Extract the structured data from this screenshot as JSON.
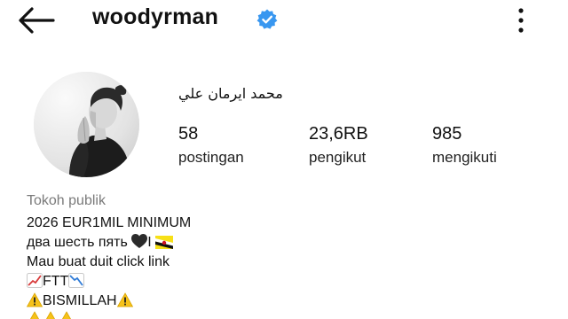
{
  "header": {
    "username": "woodyrman",
    "back_icon": "arrow-left-icon",
    "verified_icon": "verified-badge-icon",
    "more_icon": "more-vertical-icon",
    "verified_color": "#3897f0"
  },
  "profile": {
    "full_name": "محمد ايرمان علي",
    "stats": {
      "posts": {
        "value": "58",
        "label": "postingan"
      },
      "followers": {
        "value": "23,6RB",
        "label": "pengikut"
      },
      "following": {
        "value": "985",
        "label": "mengikuti"
      }
    }
  },
  "bio": {
    "category": "Tokoh publik",
    "line1": "2026 EUR1MIL MINIMUM",
    "line2": "два шесть пять",
    "line2_bar": "I",
    "line3": "Mau buat duit click link",
    "line4": "FTT",
    "line5": "BISMILLAH",
    "emojis": {
      "heart": "black-heart-icon",
      "flag": "brunei-flag-icon",
      "chart_up": "chart-increasing-icon",
      "chart_down": "chart-decreasing-icon",
      "warning": "warning-icon"
    }
  }
}
